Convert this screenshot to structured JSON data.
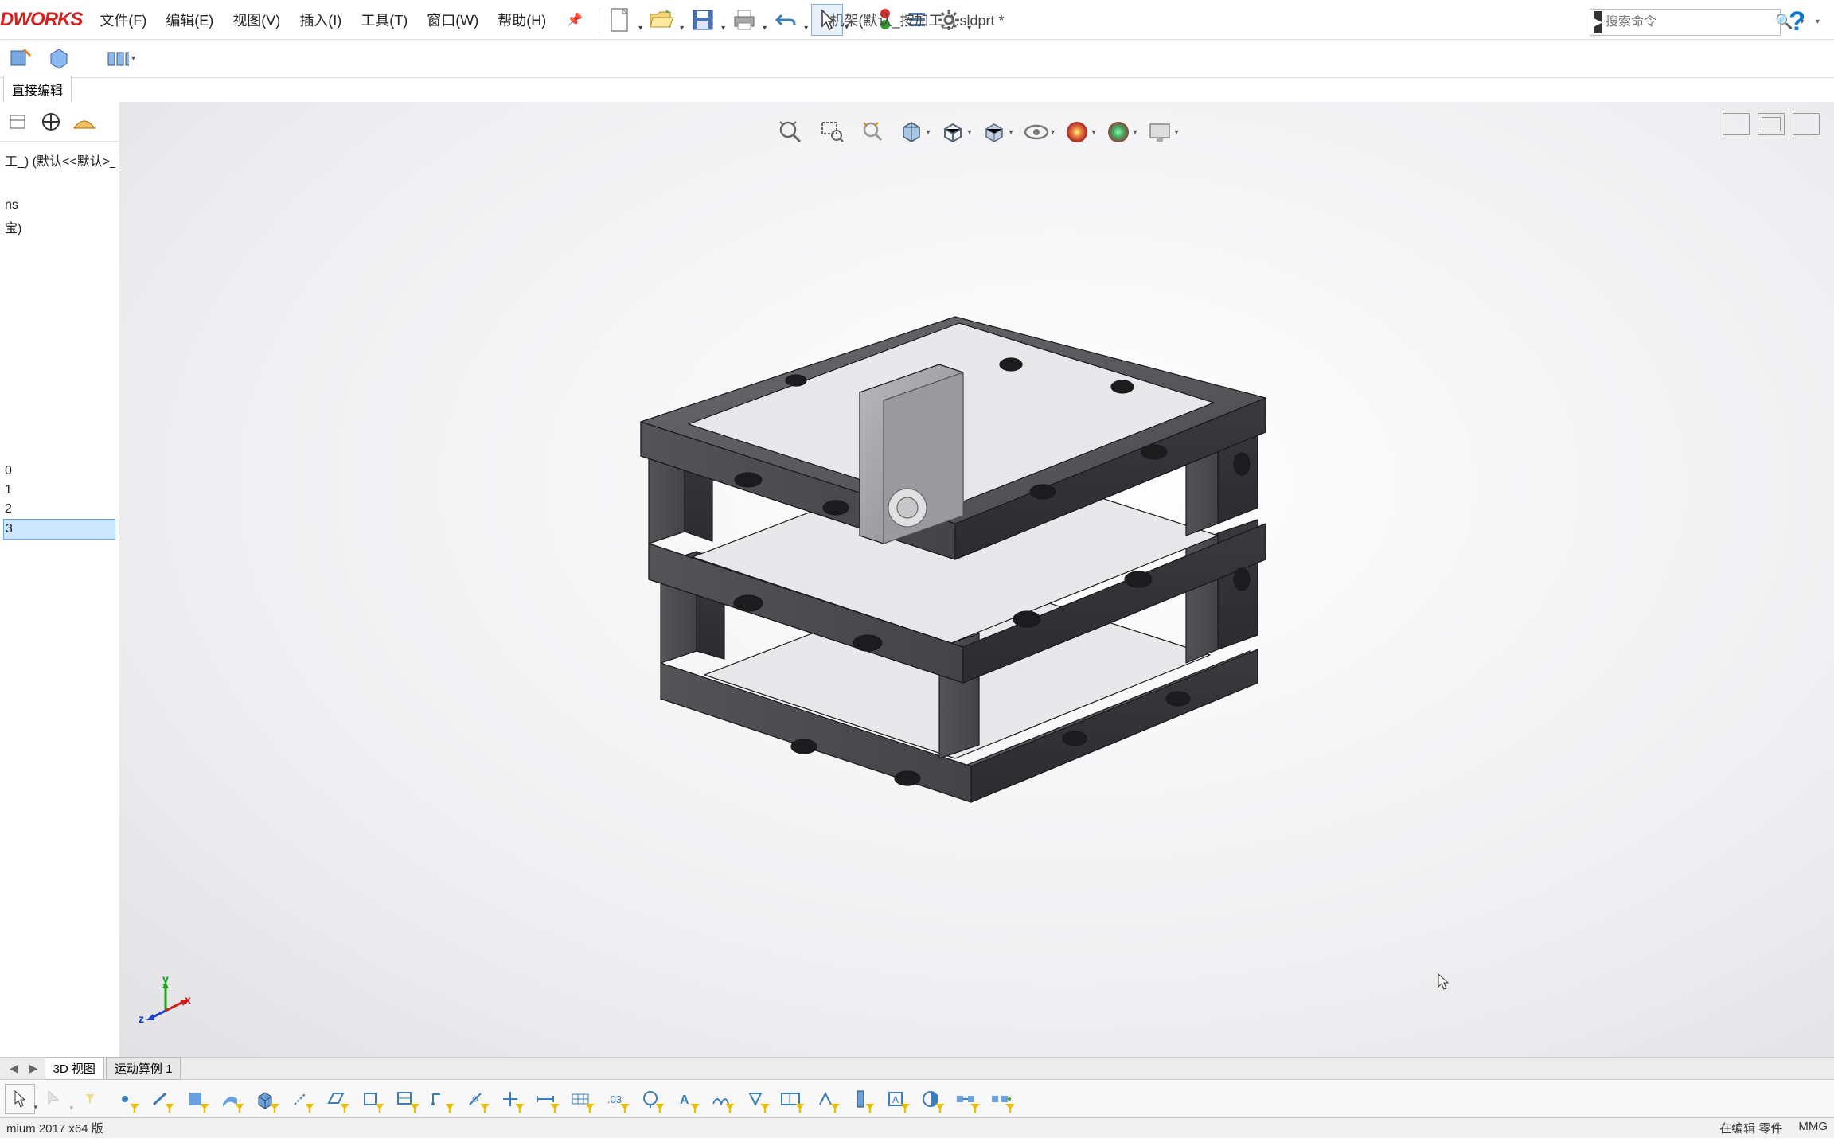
{
  "app": {
    "logo": "DWORKS"
  },
  "menu": {
    "file": "文件(F)",
    "edit": "编辑(E)",
    "view": "视图(V)",
    "insert": "插入(I)",
    "tools": "工具(T)",
    "window": "窗口(W)",
    "help": "帮助(H)"
  },
  "title": {
    "doc": "机架(默认_按加工_).sldprt *"
  },
  "search": {
    "placeholder": "搜索命令"
  },
  "tabs": {
    "direct_edit": "直接编辑"
  },
  "tree": {
    "root": "工_) (默认<<默认>_显",
    "items": [
      "ns",
      "宝)",
      "",
      "",
      "",
      "0",
      "1",
      "2",
      "3"
    ]
  },
  "bottom_tabs": {
    "view3d": "3D 视图",
    "motion": "运动算例 1"
  },
  "status": {
    "left": "mium 2017 x64 版",
    "edit": "在编辑 零件",
    "units": "MMG"
  },
  "triad": {
    "x": "x",
    "y": "y",
    "z": "z"
  }
}
